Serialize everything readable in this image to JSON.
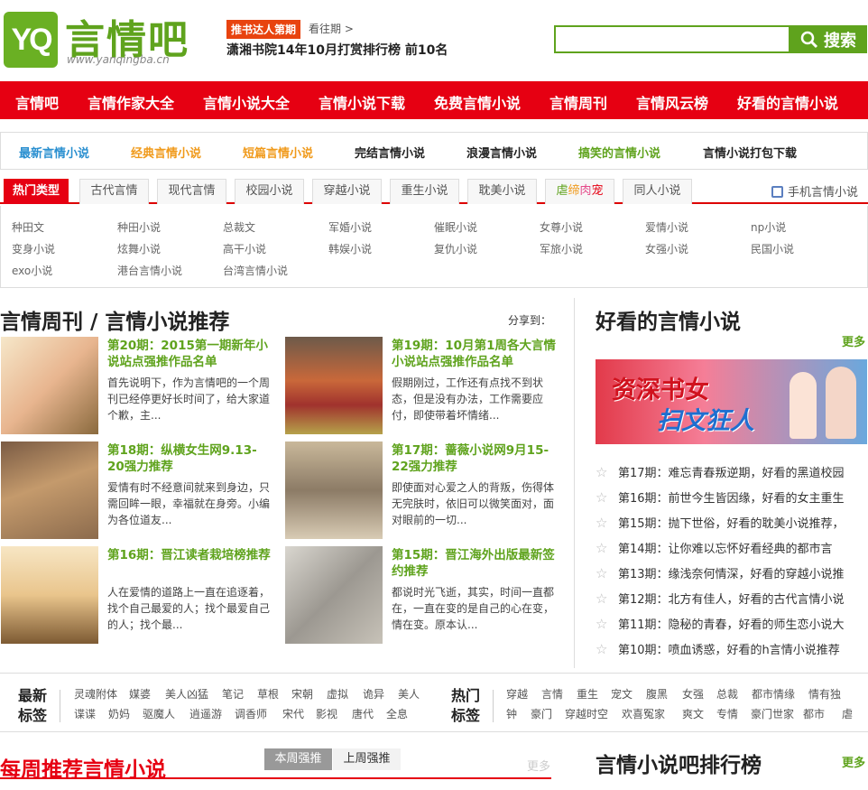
{
  "header": {
    "logo_mark": "YQ",
    "logo_text": "言情吧",
    "logo_url": "www.yanqingba.cn",
    "promo_badge": "推书达人第期",
    "promo_past": "看往期 >",
    "promo_title": "潇湘书院14年10月打赏排行榜 前10名",
    "search_placeholder": "",
    "search_label": "搜索"
  },
  "nav": [
    "言情吧",
    "言情作家大全",
    "言情小说大全",
    "言情小说下载",
    "免费言情小说",
    "言情周刊",
    "言情风云榜",
    "好看的言情小说"
  ],
  "subnav": [
    {
      "label": "最新言情小说",
      "color": "#2a8fd0"
    },
    {
      "label": "经典言情小说",
      "color": "#f09a1b"
    },
    {
      "label": "短篇言情小说",
      "color": "#f09a1b"
    },
    {
      "label": "完结言情小说",
      "color": "#222"
    },
    {
      "label": "浪漫言情小说",
      "color": "#222"
    },
    {
      "label": "搞笑的言情小说",
      "color": "#5fa31d"
    },
    {
      "label": "言情小说打包下载",
      "color": "#222"
    }
  ],
  "tag_tabs": {
    "hot": "热门类型",
    "tabs": [
      "古代言情",
      "现代言情",
      "校园小说",
      "穿越小说",
      "重生小说",
      "耽美小说",
      "虐",
      "缔",
      "肉",
      "宠",
      "同人小说"
    ],
    "mobile": "手机言情小说"
  },
  "tag_rows": [
    [
      "种田文",
      "种田小说",
      "总裁文",
      "军婚小说",
      "催眠小说",
      "女尊小说",
      "爱情小说",
      "np小说"
    ],
    [
      "变身小说",
      "炫舞小说",
      "高干小说",
      "韩娱小说",
      "复仇小说",
      "军旅小说",
      "女强小说",
      "民国小说"
    ],
    [
      "exo小说",
      "港台言情小说",
      "台湾言情小说"
    ]
  ],
  "weekly": {
    "title": "言情周刊 / 言情小说推荐",
    "share": "分享到：",
    "cards": [
      {
        "title": "第20期：2015第一期新年小说站点强推作品名单",
        "desc": "首先说明下，作为言情吧的一个周刊已经停更好长时间了，给大家道个歉，主..."
      },
      {
        "title": "第19期：10月第1周各大言情小说站点强推作品名单",
        "desc": "假期刚过，工作还有点找不到状态，但是没有办法，工作需要应付，即使带着坏情绪..."
      },
      {
        "title": "第18期：纵横女生网9.13-20强力推荐",
        "desc": "爱情有时不经意间就来到身边，只需回眸一眼，幸福就在身旁。小编为各位道友..."
      },
      {
        "title": "第17期：蔷薇小说网9月15-22强力推荐",
        "desc": "即使面对心爱之人的背叛，伤得体无完肤时，依旧可以微笑面对，面对眼前的一切..."
      },
      {
        "title": "第16期：晋江读者栽培榜推荐",
        "desc": "人在爱情的道路上一直在追逐着，找个自己最爱的人；找个最爱自己的人；找个最..."
      },
      {
        "title": "第15期：晋江海外出版最新签约推荐",
        "desc": "都说时光飞逝，其实，时间一直都在，一直在变的是自己的心在变，情在变。原本认..."
      }
    ]
  },
  "right": {
    "title": "好看的言情小说",
    "more": "更多",
    "banner_line1": "资深书女",
    "banner_line2": "扫文狂人",
    "list": [
      "第17期：难忘青春叛逆期，好看的黑道校园",
      "第16期：前世今生皆因缘，好看的女主重生",
      "第15期：抛下世俗，好看的耽美小说推荐，",
      "第14期：让你难以忘怀好看经典的都市言",
      "第13期：缘浅奈何情深，好看的穿越小说推",
      "第12期：北方有佳人，好看的古代言情小说",
      "第11期：隐秘的青春，好看的师生恋小说大",
      "第10期：喷血诱惑，好看的h言情小说推荐"
    ]
  },
  "tagsbar": {
    "new_head": [
      "最新",
      "标签"
    ],
    "new_row1": [
      "灵魂附体",
      "媒婆",
      "美人凶猛",
      "笔记",
      "草根",
      "宋朝",
      "虚拟",
      "诡异",
      "美人"
    ],
    "new_row2": [
      "谍谍",
      "奶妈",
      "驱魔人",
      "逍遥游",
      "调香师",
      "宋代",
      "影视",
      "唐代",
      "全息"
    ],
    "hot_head": [
      "热门",
      "标签"
    ],
    "hot_row1": [
      "穿越",
      "言情",
      "重生",
      "宠文",
      "腹黑",
      "女强",
      "总裁",
      "都市情缘",
      "情有独"
    ],
    "hot_row2": [
      "钟",
      "豪门",
      "穿越时空",
      "欢喜冤家",
      "爽文",
      "专情",
      "豪门世家",
      "都市",
      "虐"
    ]
  },
  "bottom": {
    "weekly_title": "每周推荐言情小说",
    "tab_this": "本周强推",
    "tab_last": "上周强推",
    "more": "更多",
    "rank_title": "言情小说吧排行榜",
    "rank_more": "更多"
  }
}
